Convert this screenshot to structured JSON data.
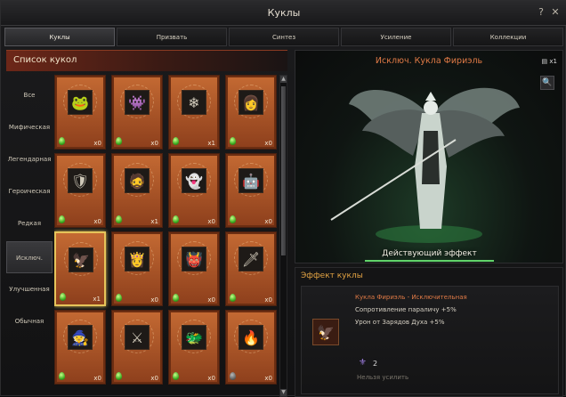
{
  "window": {
    "title": "Куклы"
  },
  "titlebar": {
    "help_icon": "?",
    "close_icon": "✕"
  },
  "tabs": [
    "Куклы",
    "Призвать",
    "Синтез",
    "Усиление",
    "Коллекции"
  ],
  "list": {
    "header": "Список кукол",
    "categories": [
      "Все",
      "Мифическая",
      "Легендарная",
      "Героическая",
      "Редкая",
      "Исключ.",
      "Улучшенная",
      "Обычная"
    ],
    "active_category": "Исключ.",
    "items": [
      {
        "icon": "frog-doll-icon",
        "glyph": "🐸",
        "count": "x0",
        "gem": "green"
      },
      {
        "icon": "teal-golem-doll-icon",
        "glyph": "👾",
        "count": "x0",
        "gem": "green"
      },
      {
        "icon": "ice-spirit-doll-icon",
        "glyph": "❄",
        "count": "x1",
        "gem": "green"
      },
      {
        "icon": "white-hair-doll-icon",
        "glyph": "👩",
        "count": "x0",
        "gem": "green"
      },
      {
        "icon": "dark-knight-doll-icon",
        "glyph": "🛡",
        "count": "x0",
        "gem": "green"
      },
      {
        "icon": "warrior-doll-icon",
        "glyph": "🧔",
        "count": "x1",
        "gem": "green"
      },
      {
        "icon": "ghost-doll-icon",
        "glyph": "👻",
        "count": "x0",
        "gem": "green"
      },
      {
        "icon": "robot-doll-icon",
        "glyph": "🤖",
        "count": "x0",
        "gem": "green"
      },
      {
        "icon": "firiel-doll-icon",
        "glyph": "🦅",
        "count": "x1",
        "gem": "green"
      },
      {
        "icon": "red-hair-doll-icon",
        "glyph": "👸",
        "count": "x0",
        "gem": "green"
      },
      {
        "icon": "orc-doll-icon",
        "glyph": "👹",
        "count": "x0",
        "gem": "green"
      },
      {
        "icon": "green-knight-doll-icon",
        "glyph": "🗡",
        "count": "x0",
        "gem": "green"
      },
      {
        "icon": "pink-mage-doll-icon",
        "glyph": "🧙",
        "count": "x0",
        "gem": "green"
      },
      {
        "icon": "silver-warrior-doll-icon",
        "glyph": "⚔",
        "count": "x0",
        "gem": "green"
      },
      {
        "icon": "horned-doll-icon",
        "glyph": "🐲",
        "count": "x0",
        "gem": "green"
      },
      {
        "icon": "fire-demon-doll-icon",
        "glyph": "🔥",
        "count": "x0",
        "gem": "gray"
      }
    ]
  },
  "detail": {
    "title": "Исключ. Кукла Фириэль",
    "owned_icon": "▤",
    "owned_count": "x1",
    "zoom_icon": "🔍",
    "active_effect_label": "Действующий эффект"
  },
  "effect": {
    "header": "Эффект куклы",
    "name": "Кукла Фириэль - Исключительная",
    "lines": [
      "Сопротивление параличу +5%",
      "Урон от Зарядов Духа +5%"
    ],
    "enhance_count": "2",
    "cannot_enhance": "Нельзя усилить"
  },
  "colors": {
    "accent_orange": "#e07a46",
    "effect_green": "#61d36a",
    "header_gold": "#e1a243"
  }
}
